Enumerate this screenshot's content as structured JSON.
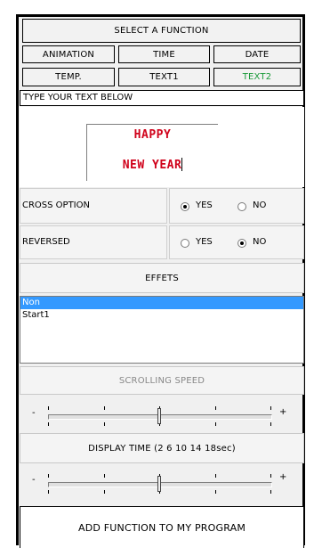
{
  "header": {
    "title": "SELECT A FUNCTION"
  },
  "functions": [
    {
      "label": "ANIMATION",
      "active": false
    },
    {
      "label": "TIME",
      "active": false
    },
    {
      "label": "DATE",
      "active": false
    },
    {
      "label": "TEMP.",
      "active": false
    },
    {
      "label": "TEXT1",
      "active": false
    },
    {
      "label": "TEXT2",
      "active": true
    }
  ],
  "text_section": {
    "label": "TYPE YOUR TEXT BELOW",
    "line1": "HAPPY",
    "line2": "NEW YEAR",
    "text_color": "#d0021b"
  },
  "cross_option": {
    "label": "CROSS OPTION",
    "yes": "YES",
    "no": "NO",
    "selected": "yes"
  },
  "reversed": {
    "label": "REVERSED",
    "yes": "YES",
    "no": "NO",
    "selected": "no"
  },
  "effects": {
    "label": "EFFETS",
    "items": [
      "Non",
      "Start1"
    ],
    "selected_index": 0
  },
  "scrolling_speed": {
    "label": "SCROLLING SPEED",
    "minus": "-",
    "plus": "+",
    "value_fraction": 0.5
  },
  "display_time": {
    "label": "DISPLAY TIME (2 6 10 14 18sec)",
    "minus": "-",
    "plus": "+",
    "value_fraction": 0.5
  },
  "footer": {
    "add_label": "ADD FUNCTION TO MY PROGRAM"
  },
  "colors": {
    "active_tab_text": "#1a9a3a",
    "selection": "#3399ff",
    "disabled_text": "#888888"
  }
}
